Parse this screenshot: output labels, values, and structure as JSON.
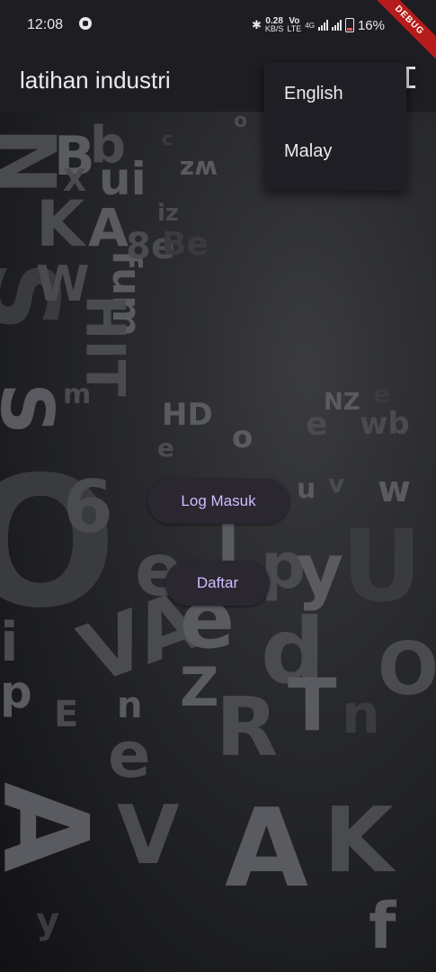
{
  "status_bar": {
    "time": "12:08",
    "net_speed_value": "0.28",
    "net_speed_unit": "KB/S",
    "volte_label": "Vo",
    "lte_label": "LTE",
    "network_label": "4G",
    "battery_percent": "16%"
  },
  "debug_banner": "DEBUG",
  "app_bar": {
    "title": "latihan industri"
  },
  "language_menu": {
    "items": [
      {
        "label": "English"
      },
      {
        "label": "Malay"
      }
    ]
  },
  "actions": {
    "login_label": "Log Masuk",
    "register_label": "Daftar"
  },
  "colors": {
    "surface": "#1e1d22",
    "button_bg": "#2a2730",
    "button_text": "#d0bcff",
    "debug_ribbon": "#b71c1c"
  }
}
